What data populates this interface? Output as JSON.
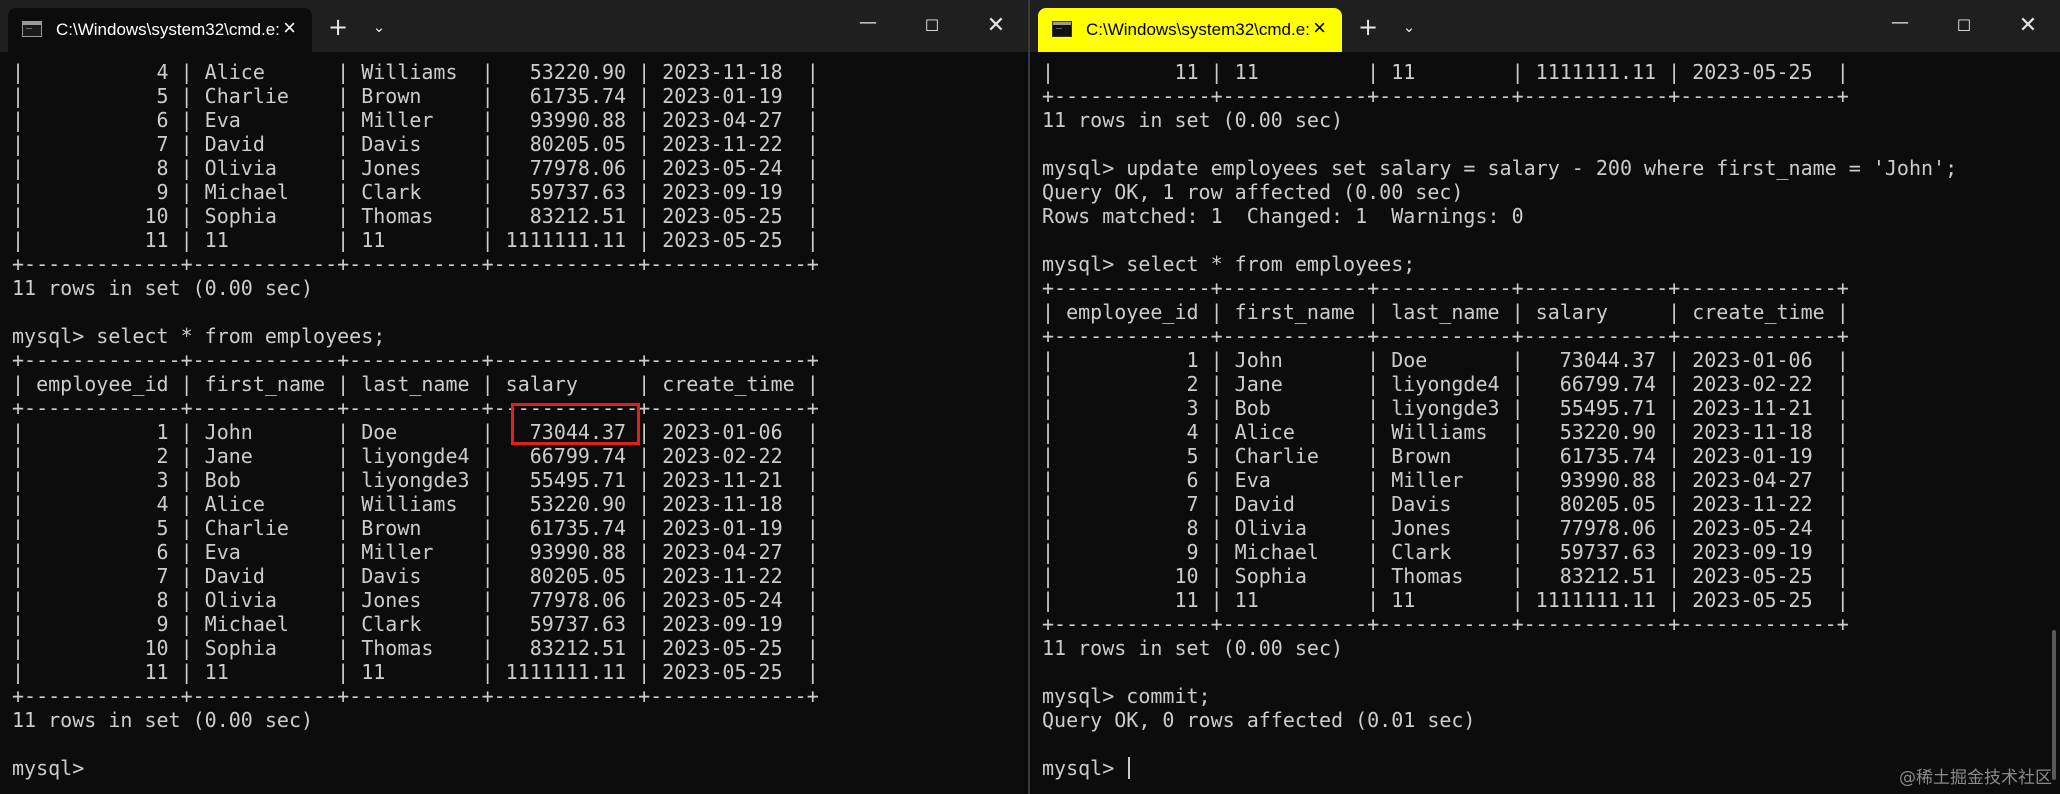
{
  "colors": {
    "background": "#0c0c0c",
    "text": "#cccccc",
    "highlight_box": "#e02020",
    "active_tab": "#ffff00"
  },
  "left_window": {
    "tab_title": "C:\\Windows\\system32\\cmd.e:",
    "icons": [
      "terminal-icon",
      "close-icon",
      "plus-icon",
      "chevron-down-icon",
      "minimize-icon",
      "maximize-icon",
      "close-icon"
    ],
    "lines": [
      "|           4 | Alice      | Williams  |   53220.90 | 2023-11-18  |",
      "|           5 | Charlie    | Brown     |   61735.74 | 2023-01-19  |",
      "|           6 | Eva        | Miller    |   93990.88 | 2023-04-27  |",
      "|           7 | David      | Davis     |   80205.05 | 2023-11-22  |",
      "|           8 | Olivia     | Jones     |   77978.06 | 2023-05-24  |",
      "|           9 | Michael    | Clark     |   59737.63 | 2023-09-19  |",
      "|          10 | Sophia     | Thomas    |   83212.51 | 2023-05-25  |",
      "|          11 | 11         | 11        | 1111111.11 | 2023-05-25  |",
      "+-------------+------------+-----------+------------+-------------+",
      "11 rows in set (0.00 sec)",
      "",
      "mysql> select * from employees;",
      "+-------------+------------+-----------+------------+-------------+",
      "| employee_id | first_name | last_name | salary     | create_time |",
      "+-------------+------------+-----------+------------+-------------+",
      "|           1 | John       | Doe       |   73044.37 | 2023-01-06  |",
      "|           2 | Jane       | liyongde4 |   66799.74 | 2023-02-22  |",
      "|           3 | Bob        | liyongde3 |   55495.71 | 2023-11-21  |",
      "|           4 | Alice      | Williams  |   53220.90 | 2023-11-18  |",
      "|           5 | Charlie    | Brown     |   61735.74 | 2023-01-19  |",
      "|           6 | Eva        | Miller    |   93990.88 | 2023-04-27  |",
      "|           7 | David      | Davis     |   80205.05 | 2023-11-22  |",
      "|           8 | Olivia     | Jones     |   77978.06 | 2023-05-24  |",
      "|           9 | Michael    | Clark     |   59737.63 | 2023-09-19  |",
      "|          10 | Sophia     | Thomas    |   83212.51 | 2023-05-25  |",
      "|          11 | 11         | 11        | 1111111.11 | 2023-05-25  |",
      "+-------------+------------+-----------+------------+-------------+",
      "11 rows in set (0.00 sec)",
      "",
      "mysql>"
    ]
  },
  "right_window": {
    "tab_title": "C:\\Windows\\system32\\cmd.e:",
    "lines": [
      "|          11 | 11         | 11        | 1111111.11 | 2023-05-25  |",
      "+-------------+------------+-----------+------------+-------------+",
      "11 rows in set (0.00 sec)",
      "",
      "mysql> update employees set salary = salary - 200 where first_name = 'John';",
      "Query OK, 1 row affected (0.00 sec)",
      "Rows matched: 1  Changed: 1  Warnings: 0",
      "",
      "mysql> select * from employees;",
      "+-------------+------------+-----------+------------+-------------+",
      "| employee_id | first_name | last_name | salary     | create_time |",
      "+-------------+------------+-----------+------------+-------------+",
      "|           1 | John       | Doe       |   73044.37 | 2023-01-06  |",
      "|           2 | Jane       | liyongde4 |   66799.74 | 2023-02-22  |",
      "|           3 | Bob        | liyongde3 |   55495.71 | 2023-11-21  |",
      "|           4 | Alice      | Williams  |   53220.90 | 2023-11-18  |",
      "|           5 | Charlie    | Brown     |   61735.74 | 2023-01-19  |",
      "|           6 | Eva        | Miller    |   93990.88 | 2023-04-27  |",
      "|           7 | David      | Davis     |   80205.05 | 2023-11-22  |",
      "|           8 | Olivia     | Jones     |   77978.06 | 2023-05-24  |",
      "|           9 | Michael    | Clark     |   59737.63 | 2023-09-19  |",
      "|          10 | Sophia     | Thomas    |   83212.51 | 2023-05-25  |",
      "|          11 | 11         | 11        | 1111111.11 | 2023-05-25  |",
      "+-------------+------------+-----------+------------+-------------+",
      "11 rows in set (0.00 sec)",
      "",
      "mysql> commit;",
      "Query OK, 0 rows affected (0.01 sec)",
      "",
      "mysql> "
    ]
  },
  "watermark": "@稀土掘金技术社区"
}
